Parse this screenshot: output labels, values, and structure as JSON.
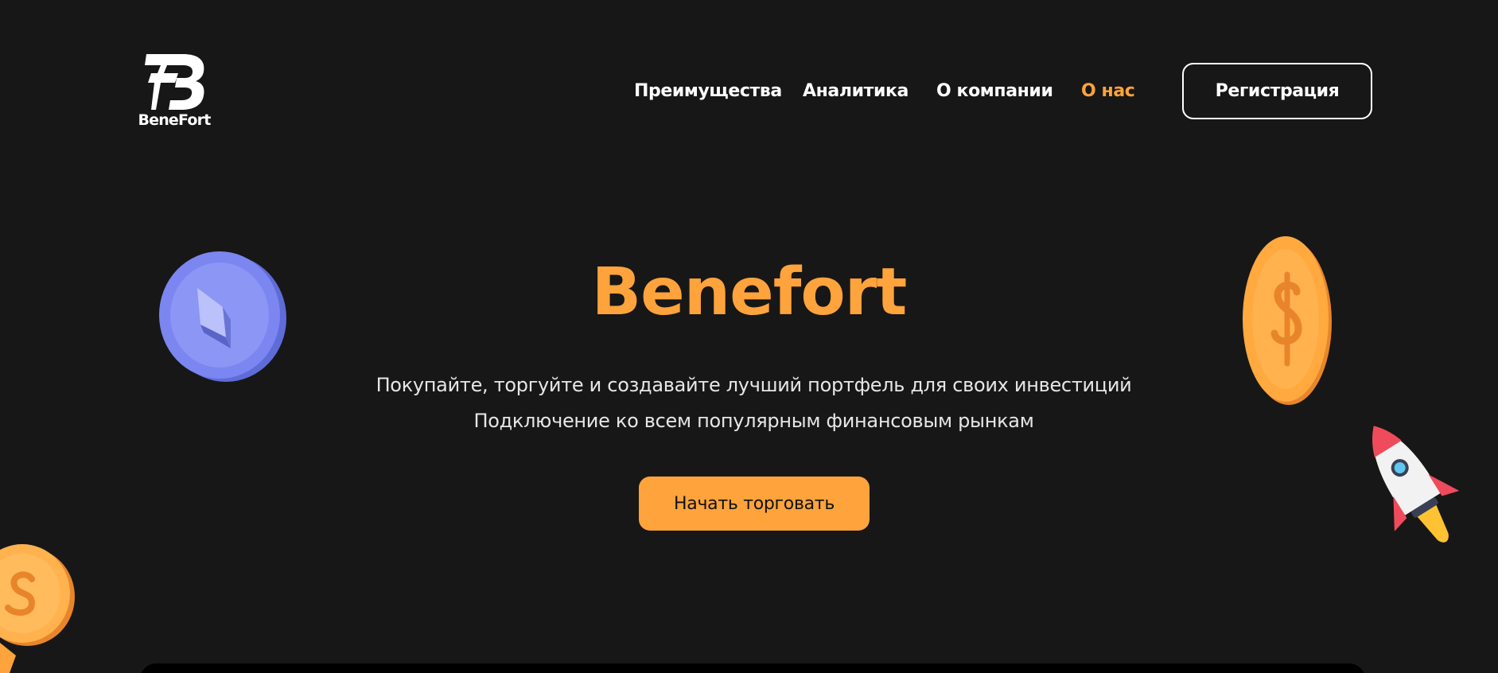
{
  "header": {
    "logo_text": "BeneFort",
    "nav": [
      {
        "label": "Преимущества"
      },
      {
        "label": "Аналитика"
      },
      {
        "label": "О компании"
      },
      {
        "label": "О нас"
      }
    ],
    "register_label": "Регистрация"
  },
  "hero": {
    "title": "Benefort",
    "subtitle_line1": "Покупайте, торгуйте и создавайте лучший портфель для своих инвестиций",
    "subtitle_line2": "Подключение ко всем популярным финансовым рынкам",
    "cta_label": "Начать торговать"
  },
  "decorations": [
    {
      "icon": "ethereum-coin-icon"
    },
    {
      "icon": "dollar-coin-icon"
    },
    {
      "icon": "rocket-icon"
    },
    {
      "icon": "dollar-coin-icon"
    }
  ],
  "colors": {
    "background": "#171717",
    "accent": "#ffa33c",
    "text": "#ffffff",
    "ethereum_coin": "#7b86f0"
  }
}
